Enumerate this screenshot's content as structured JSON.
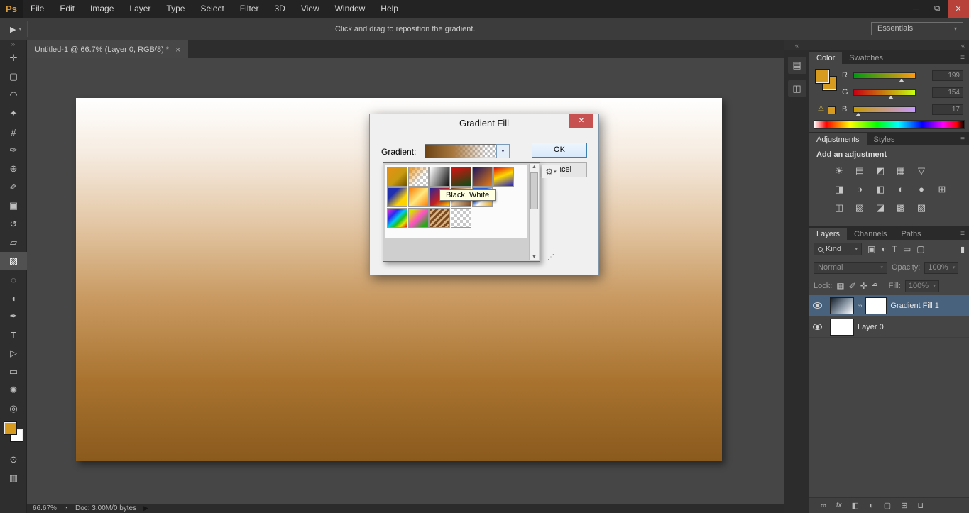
{
  "menubar": {
    "logo": "Ps",
    "items": [
      "File",
      "Edit",
      "Image",
      "Layer",
      "Type",
      "Select",
      "Filter",
      "3D",
      "View",
      "Window",
      "Help"
    ],
    "minimize": "─",
    "restore": "⧉",
    "close": "✕"
  },
  "optionsbar": {
    "tool_icon": "▶",
    "tool_arrow": "▾",
    "hint": "Click and drag to reposition the gradient.",
    "workspace": "Essentials",
    "workspace_arrow": "▾"
  },
  "toolstrip": {
    "collapse": "››",
    "tools": [
      {
        "name": "move-tool",
        "glyph": "✛"
      },
      {
        "name": "rectangular-marquee-tool",
        "glyph": "▢"
      },
      {
        "name": "lasso-tool",
        "glyph": "◠"
      },
      {
        "name": "quick-selection-tool",
        "glyph": "✦"
      },
      {
        "name": "crop-tool",
        "glyph": "#"
      },
      {
        "name": "eyedropper-tool",
        "glyph": "✑"
      },
      {
        "name": "spot-healing-brush-tool",
        "glyph": "⊕"
      },
      {
        "name": "brush-tool",
        "glyph": "✐"
      },
      {
        "name": "clone-stamp-tool",
        "glyph": "▣"
      },
      {
        "name": "history-brush-tool",
        "glyph": "↺"
      },
      {
        "name": "eraser-tool",
        "glyph": "▱"
      },
      {
        "name": "gradient-tool",
        "glyph": "▨"
      },
      {
        "name": "blur-tool",
        "glyph": "◌"
      },
      {
        "name": "dodge-tool",
        "glyph": "◖"
      },
      {
        "name": "pen-tool",
        "glyph": "✒"
      },
      {
        "name": "type-tool",
        "glyph": "T"
      },
      {
        "name": "path-selection-tool",
        "glyph": "▷"
      },
      {
        "name": "rectangle-tool",
        "glyph": "▭"
      },
      {
        "name": "hand-tool",
        "glyph": "✺"
      },
      {
        "name": "zoom-tool",
        "glyph": "◎"
      }
    ],
    "fg_style": "background:#d79b1f",
    "bg_style": "background:#ffffff",
    "quick_mask_glyph": "⊙",
    "screen_mode_glyph": "▥"
  },
  "tabbar": {
    "title": "Untitled-1 @ 66.7% (Layer 0, RGB/8) *",
    "close": "×"
  },
  "canvas": {
    "doc_style": "background:linear-gradient(180deg,#ffffff 0%,#f6ece1 15%,#e3c6a4 35%,#c99a62 55%,#a9732f 78%,#8a5a1d 100%)"
  },
  "dialog": {
    "title": "Gradient Fill",
    "close": "✕",
    "gradient_label": "Gradient:",
    "preview_style": "background:linear-gradient(to right,#6e4414,#a87840 40%,rgba(200,160,110,0) 85%),repeating-conic-gradient(#bbbbbb 0 25%,#ffffff 0 50%) 0 0/7px 7px",
    "dropdown_arrow": "▼",
    "ok": "OK",
    "cancel": "Cancel",
    "gear": "⚙",
    "gear_arrow": "▾",
    "tooltip": "Black, White",
    "grip": "⋰",
    "scroll_up": "▲",
    "scroll_down": "▼",
    "presets": [
      {
        "name": "foreground-to-background",
        "style": "background:linear-gradient(135deg,#e89015,#c79a11 55%,#6e5200)"
      },
      {
        "name": "foreground-to-transparent",
        "style": "background:linear-gradient(135deg,rgba(232,144,21,0.95),rgba(232,144,21,0) 60%),repeating-conic-gradient(#c8c8c8 0 25%,#ffffff 0 50%) 0 0/8px 8px"
      },
      {
        "name": "black-white",
        "style": "background:linear-gradient(115deg,#ffffff,#0a0a0a)"
      },
      {
        "name": "red-green",
        "style": "background:linear-gradient(160deg,#d91111,#0b4d14)"
      },
      {
        "name": "violet-orange",
        "style": "background:linear-gradient(135deg,#1c1660,#e87c12)"
      },
      {
        "name": "red-yellow-blue",
        "style": "background:linear-gradient(160deg,#e01010,#ffd900 45%,#2424c4)"
      },
      {
        "name": "blue-yellow-blue",
        "style": "background:linear-gradient(135deg,#1f2fb0 30%,#ffd400 70%)"
      },
      {
        "name": "orange-yellow-orange",
        "style": "background:linear-gradient(135deg,#ff7a00,#ffe980 50%,#ff7a00)"
      },
      {
        "name": "blue-red-yellow",
        "style": "background:linear-gradient(135deg,#27279a,#c42020 52%,#ffd400)"
      },
      {
        "name": "copper",
        "style": "background:linear-gradient(135deg,#6e3a1a,#e8c9a0 45%,#7a4520)"
      },
      {
        "name": "blue-white-gold",
        "style": "background:linear-gradient(135deg,#2a5fd0 38%,#ffffff 58%,#e8a000)"
      },
      {
        "name": "rainbow",
        "style": "background:linear-gradient(135deg,#ff30d0,#2a2af0 30%,#00c8f0 50%,#20c020 65%,#e8e000 82%,#e02020)"
      },
      {
        "name": "yellow-pink-green",
        "style": "background:linear-gradient(135deg,#d8e000 15%,#ff50c8 50%,#28a818 85%)"
      },
      {
        "name": "copper-stripes",
        "style": "background:repeating-linear-gradient(135deg,#7a4a20 0 3px,#d9b280 3px 6px)"
      },
      {
        "name": "transparent-checker",
        "style": "background:repeating-conic-gradient(#c8c8c8 0 25%,#ffffff 0 50%) 0 0/8px 8px"
      }
    ]
  },
  "dock": {
    "collapse": "«",
    "buttons": [
      {
        "name": "history-panel-button",
        "glyph": "▤"
      },
      {
        "name": "properties-panel-button",
        "glyph": "◫"
      }
    ]
  },
  "panels": {
    "collapse": "«"
  },
  "color_panel": {
    "tabs": [
      "Color",
      "Swatches"
    ],
    "menu": "≡",
    "fg_style": "background:#d79b1f",
    "bg_style": "background:#d79b1f",
    "warning": "⚠",
    "warning_swatch_style": "background:#d79b1f",
    "channels": [
      {
        "label": "R",
        "value": "199",
        "slider_style": "background:linear-gradient(to right,#009a11,#ff9a11)",
        "handle_style": "left:78%"
      },
      {
        "label": "G",
        "value": "154",
        "slider_style": "background:linear-gradient(to right,#c70011,#c7ff11)",
        "handle_style": "left:60%"
      },
      {
        "label": "B",
        "value": "17",
        "slider_style": "background:linear-gradient(to right,#c79a00,#c79aff)",
        "handle_style": "left:7%"
      }
    ],
    "spectrum_style": "background:linear-gradient(to right,#ffffff 0%,#ff0000 8%,#ffff00 24%,#00ff00 42%,#00ffff 56%,#0000ff 72%,#ff00ff 86%,#ff0000 95%,#000000 100%)"
  },
  "adjustments_panel": {
    "tabs": [
      "Adjustments",
      "Styles"
    ],
    "title": "Add an adjustment",
    "rows": [
      [
        {
          "name": "brightness-contrast-icon",
          "glyph": "☀"
        },
        {
          "name": "levels-icon",
          "glyph": "▤"
        },
        {
          "name": "curves-icon",
          "glyph": "◩"
        },
        {
          "name": "exposure-icon",
          "glyph": "▦"
        },
        {
          "name": "vibrance-icon",
          "glyph": "▽"
        }
      ],
      [
        {
          "name": "hue-saturation-icon",
          "glyph": "◨"
        },
        {
          "name": "color-balance-icon",
          "glyph": "◑"
        },
        {
          "name": "black-white-icon",
          "glyph": "◧"
        },
        {
          "name": "photo-filter-icon",
          "glyph": "◐"
        },
        {
          "name": "channel-mixer-icon",
          "glyph": "●"
        },
        {
          "name": "color-lookup-icon",
          "glyph": "⊞"
        }
      ],
      [
        {
          "name": "invert-icon",
          "glyph": "◫"
        },
        {
          "name": "posterize-icon",
          "glyph": "▨"
        },
        {
          "name": "threshold-icon",
          "glyph": "◪"
        },
        {
          "name": "gradient-map-icon",
          "glyph": "▩"
        },
        {
          "name": "selective-color-icon",
          "glyph": "▧"
        }
      ]
    ]
  },
  "layers_panel": {
    "tabs": [
      "Layers",
      "Channels",
      "Paths"
    ],
    "menu": "≡",
    "kind": "Kind",
    "kind_arrow": "▾",
    "filter_icons": [
      {
        "name": "pixel-layer-filter-icon",
        "glyph": "▣"
      },
      {
        "name": "adjustment-layer-filter-icon",
        "glyph": "◐"
      },
      {
        "name": "type-layer-filter-icon",
        "glyph": "T"
      },
      {
        "name": "shape-layer-filter-icon",
        "glyph": "▭"
      },
      {
        "name": "smart-object-filter-icon",
        "glyph": "▢"
      }
    ],
    "filter_toggle": "▮",
    "blend_mode": "Normal",
    "blend_arrow": "▾",
    "opacity_label": "Opacity:",
    "opacity": "100%",
    "lock_label": "Lock:",
    "lock_icons": [
      {
        "name": "lock-transparent-pixels-icon",
        "glyph": "▦"
      },
      {
        "name": "lock-image-pixels-icon",
        "glyph": "✐"
      },
      {
        "name": "lock-position-icon",
        "glyph": "✛"
      }
    ],
    "fill_label": "Fill:",
    "fill": "100%",
    "layers": [
      {
        "name": "Gradient Fill 1",
        "thumb_style": "background:linear-gradient(135deg,#141e2a,#8d9aa8 55%,#ffffff)",
        "link": "∞",
        "mask_style": "background:#ffffff"
      },
      {
        "name": "Layer 0",
        "thumb_style": "background:#ffffff"
      }
    ],
    "bottom_icons": [
      {
        "name": "link-layers-icon",
        "glyph": "∞"
      },
      {
        "name": "layer-effects-icon",
        "glyph": "fx"
      },
      {
        "name": "add-layer-mask-icon",
        "glyph": "◧"
      },
      {
        "name": "new-adjustment-layer-icon",
        "glyph": "◐"
      },
      {
        "name": "new-group-icon",
        "glyph": "▢"
      },
      {
        "name": "new-layer-icon",
        "glyph": "⊞"
      },
      {
        "name": "delete-layer-icon",
        "glyph": "⊔"
      }
    ]
  },
  "statusbar": {
    "zoom": "66.67%",
    "icon": "◔",
    "doc": "Doc: 3.00M/0 bytes",
    "arrow": "▶"
  }
}
